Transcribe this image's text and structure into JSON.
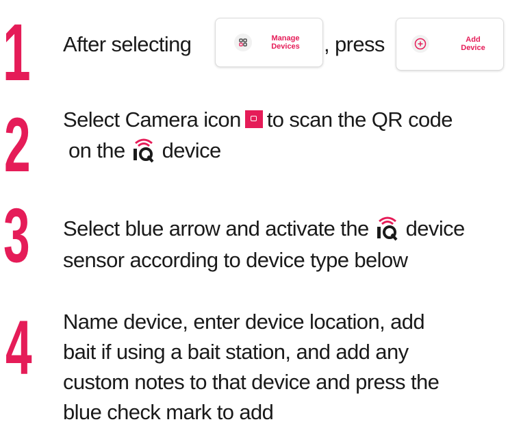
{
  "steps": [
    {
      "number": "1",
      "text_before": "After selecting",
      "text_middle": ", press"
    },
    {
      "number": "2",
      "line1_before": "Select Camera icon",
      "line1_after": "to scan the QR code",
      "line2_before": "on the",
      "line2_after": "device"
    },
    {
      "number": "3",
      "line1_before": "Select blue arrow and activate the",
      "line1_after": "device",
      "line2": "sensor according to device type below"
    },
    {
      "number": "4",
      "lines": [
        "Name device, enter device location, add",
        "bait if using a bait station, and add any",
        "custom notes to that device and press the",
        "blue check mark to add"
      ]
    }
  ],
  "buttons": {
    "manage": {
      "line1": "Manage",
      "line2": "Devices",
      "icon": "grid-icon"
    },
    "add": {
      "line1": "Add",
      "line2": "Device",
      "icon": "plus-circle-icon"
    }
  },
  "colors": {
    "accent": "#e51c58",
    "text": "#1a1a1a"
  }
}
